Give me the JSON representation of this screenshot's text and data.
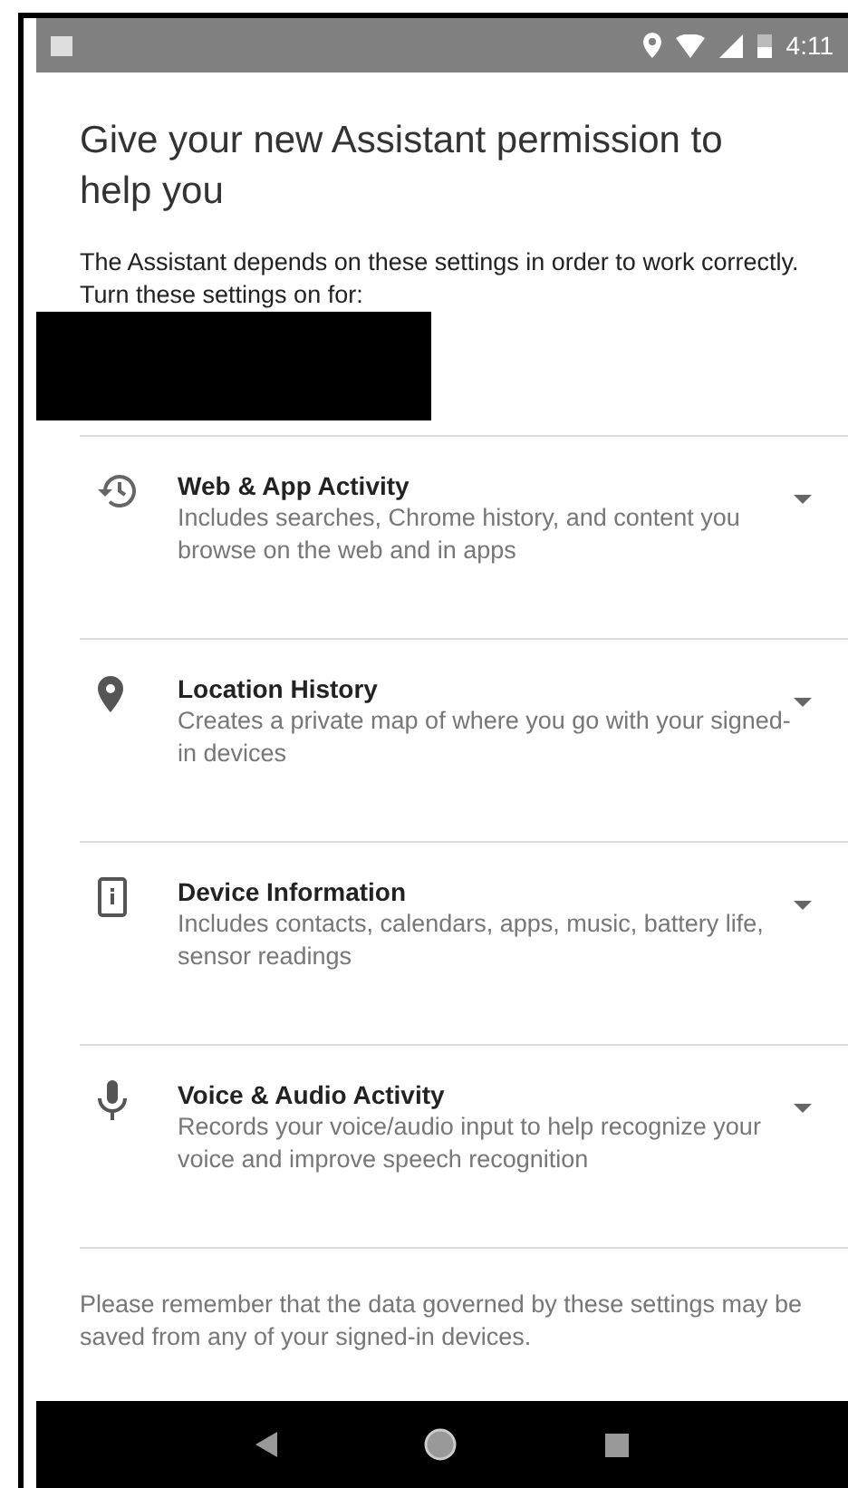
{
  "status_bar": {
    "time": "4:11"
  },
  "title": "Give your new Assistant permission to help you",
  "intro": "The Assistant depends on these settings in order to work correctly. Turn these settings on for:",
  "settings": [
    {
      "kind": "history",
      "title": "Web & App Activity",
      "description": "Includes searches, Chrome history, and content you browse on the web and in apps",
      "expanded": false
    },
    {
      "kind": "location",
      "title": "Location History",
      "description": "Creates a private map of where you go with your signed-in devices",
      "expanded": false
    },
    {
      "kind": "device",
      "title": "Device Information",
      "description": "Includes contacts, calendars, apps, music, battery life, sensor readings",
      "expanded": false
    },
    {
      "kind": "voice",
      "title": "Voice & Audio Activity",
      "description": "Records your voice/audio input to help recognize your voice and improve speech recognition",
      "expanded": false
    }
  ],
  "footer": "Please remember that the data governed by these settings may be saved from any of your signed-in devices."
}
